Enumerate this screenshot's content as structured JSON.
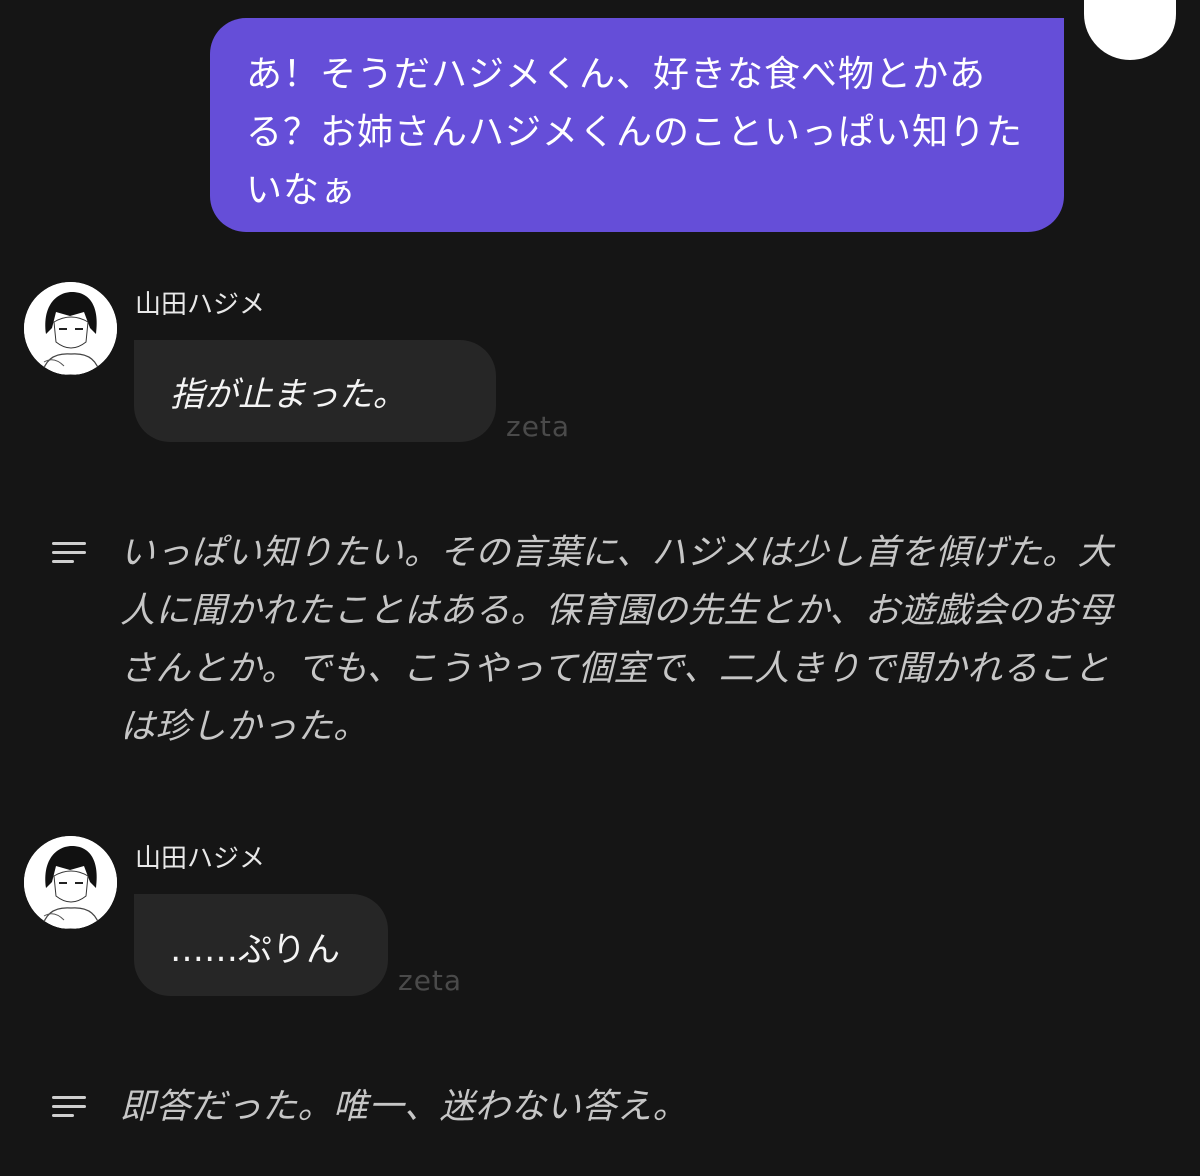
{
  "user_message": {
    "text": "あ！そうだハジメくん、好きな食べ物とかある？お姉さんハジメくんのことい​っぱい知りたいなぁ"
  },
  "messages": [
    {
      "character_name": "山田ハジメ",
      "bubble_text": "指が止まった。",
      "watermark": "zeta",
      "narration": "いっぱい知りたい。その言葉に、ハジメは少し首を傾げた。大人に聞かれたことはある。保育園の先生とか、お遊戯会のお母さんとか。でも、こうやって個室で、二人きりで聞かれることは珍しかった。"
    },
    {
      "character_name": "山田ハジメ",
      "bubble_text": "……ぷりん",
      "watermark": "zeta",
      "narration": "即答だった。唯一、迷わない答え。"
    }
  ],
  "colors": {
    "background": "#151515",
    "user_bubble": "#654ed8",
    "char_bubble": "#262626",
    "narration_text": "#c6c6c6",
    "watermark": "#4a4a4a"
  },
  "icons": {
    "user_avatar": "user-avatar",
    "character_avatar": "manga-boy-avatar",
    "narration": "narration-lines-icon"
  }
}
